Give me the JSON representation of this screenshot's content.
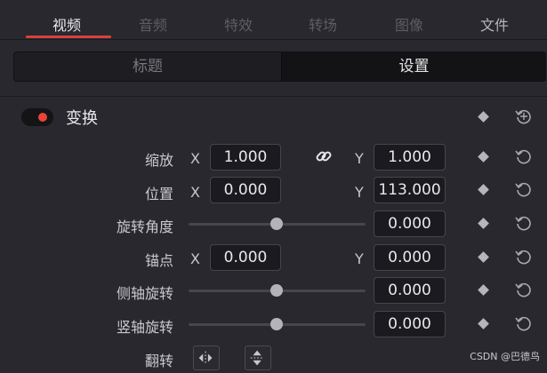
{
  "top_tabs": [
    {
      "label": "视频",
      "active": true
    },
    {
      "label": "音频",
      "active": false
    },
    {
      "label": "特效",
      "active": false
    },
    {
      "label": "转场",
      "active": false
    },
    {
      "label": "图像",
      "active": false
    },
    {
      "label": "文件",
      "active": false
    }
  ],
  "segments": {
    "title": "标题",
    "settings": "设置",
    "selected": "设置"
  },
  "section": {
    "title": "变换",
    "enabled": true
  },
  "rows": {
    "zoom": {
      "label": "缩放",
      "x_axis": "X",
      "x": "1.000",
      "y_axis": "Y",
      "y": "1.000",
      "linked": true
    },
    "position": {
      "label": "位置",
      "x_axis": "X",
      "x": "0.000",
      "y_axis": "Y",
      "y": "113.000"
    },
    "rotation": {
      "label": "旋转角度",
      "value": "0.000",
      "slider": 0.5
    },
    "anchor": {
      "label": "锚点",
      "x_axis": "X",
      "x": "0.000",
      "y_axis": "Y",
      "y": "0.000"
    },
    "pitch": {
      "label": "侧轴旋转",
      "value": "0.000",
      "slider": 0.5
    },
    "yaw": {
      "label": "竖轴旋转",
      "value": "0.000",
      "slider": 0.5
    },
    "flip": {
      "label": "翻转"
    }
  },
  "colors": {
    "accent": "#d6413d",
    "toggle_dot": "#e8443a",
    "background": "#28282e"
  },
  "watermark": "CSDN @巴德鸟"
}
